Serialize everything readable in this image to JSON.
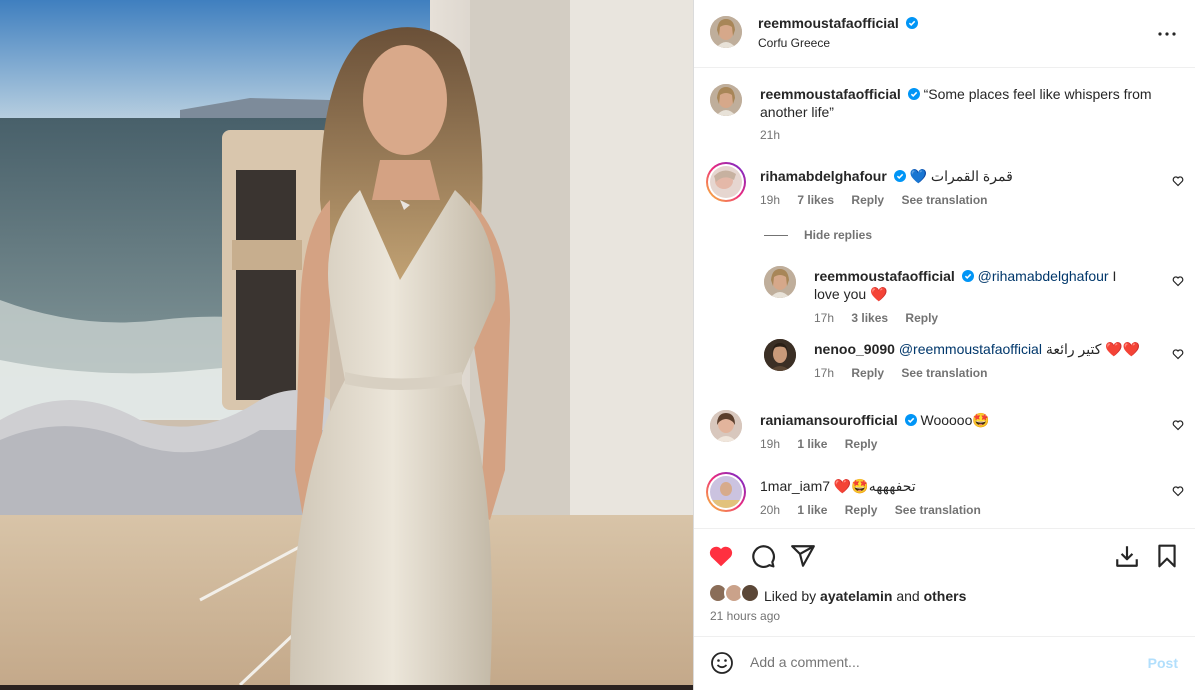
{
  "post": {
    "author": "reemmoustafaofficial",
    "location": "Corfu Greece",
    "caption": "“Some places feel like whispers from another life”",
    "caption_time": "21h"
  },
  "comments": [
    {
      "user": "rihamabdelghafour",
      "text": "قمرة القمرات",
      "emoji": "💙",
      "time": "19h",
      "likes": "7 likes",
      "reply": "Reply",
      "translate": "See translation",
      "hide_replies": "Hide replies",
      "replies": [
        {
          "user": "reemmoustafaofficial",
          "mention": "@rihamabdelghafour",
          "text": "I love you",
          "emoji": "❤️",
          "time": "17h",
          "likes": "3 likes",
          "reply": "Reply"
        },
        {
          "user": "nenoo_9090",
          "mention": "@reemmoustafaofficial",
          "text": "كتير رائعة",
          "emoji": "❤️❤️",
          "time": "17h",
          "reply": "Reply",
          "translate": "See translation"
        }
      ]
    },
    {
      "user": "raniamansourofficial",
      "text": "Wooooo🤩",
      "time": "19h",
      "likes": "1 like",
      "reply": "Reply"
    },
    {
      "user": "1mar_iam7",
      "text": "❤️🤩تحفهههه",
      "time": "20h",
      "likes": "1 like",
      "reply": "Reply",
      "translate": "See translation"
    }
  ],
  "likes_summary": {
    "prefix": "Liked by",
    "user": "ayatelamin",
    "joiner": "and",
    "others": "others",
    "time_ago": "21 hours ago"
  },
  "comment_box": {
    "placeholder": "Add a comment...",
    "post_label": "Post"
  },
  "colors": {
    "liked_heart": "#ff3040",
    "verified": "#0095f6",
    "mention": "#00376b",
    "post_disabled": "#b2dffc"
  },
  "icons": [
    "more-options-icon",
    "verified-badge-icon",
    "heart-icon",
    "comment-icon",
    "share-icon",
    "download-icon",
    "bookmark-icon",
    "emoji-icon"
  ]
}
